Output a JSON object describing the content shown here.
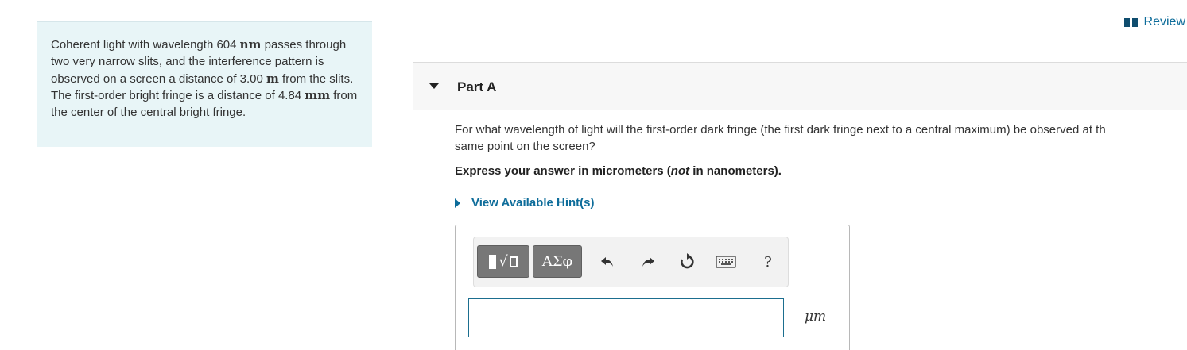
{
  "problem": {
    "segments": [
      {
        "text": "Coherent light with wavelength 604 ",
        "math": false
      },
      {
        "text": "nm",
        "math": true
      },
      {
        "text": " passes through two very narrow slits, and the interference pattern is observed on a screen a distance of 3.00 ",
        "math": false
      },
      {
        "text": "m",
        "math": true
      },
      {
        "text": " from the slits. The first-order bright fringe is a distance of 4.84 ",
        "math": false
      },
      {
        "text": "mm",
        "math": true
      },
      {
        "text": " from the center of the central bright fringe.",
        "math": false
      }
    ]
  },
  "review": {
    "label": "Review",
    "icon": "book-icon"
  },
  "part": {
    "label": "Part A"
  },
  "question": {
    "line1": "For what wavelength of light will the first-order dark fringe (the first dark fringe next to a central maximum) be observed at th",
    "line2": "same point on the screen?"
  },
  "instruction": {
    "before": "Express your answer in micrometers (",
    "emphasis": "not",
    "after": " in nanometers)."
  },
  "hint": {
    "label": "View Available Hint(s)"
  },
  "toolbar": {
    "symbols_label": "ΑΣφ",
    "help_label": "?"
  },
  "answer": {
    "value": "",
    "unit": "μm"
  },
  "colors": {
    "link": "#0d6c9a",
    "panel_bg": "#e8f5f7",
    "button_gray": "#777777",
    "input_border": "#1b6e8f"
  }
}
